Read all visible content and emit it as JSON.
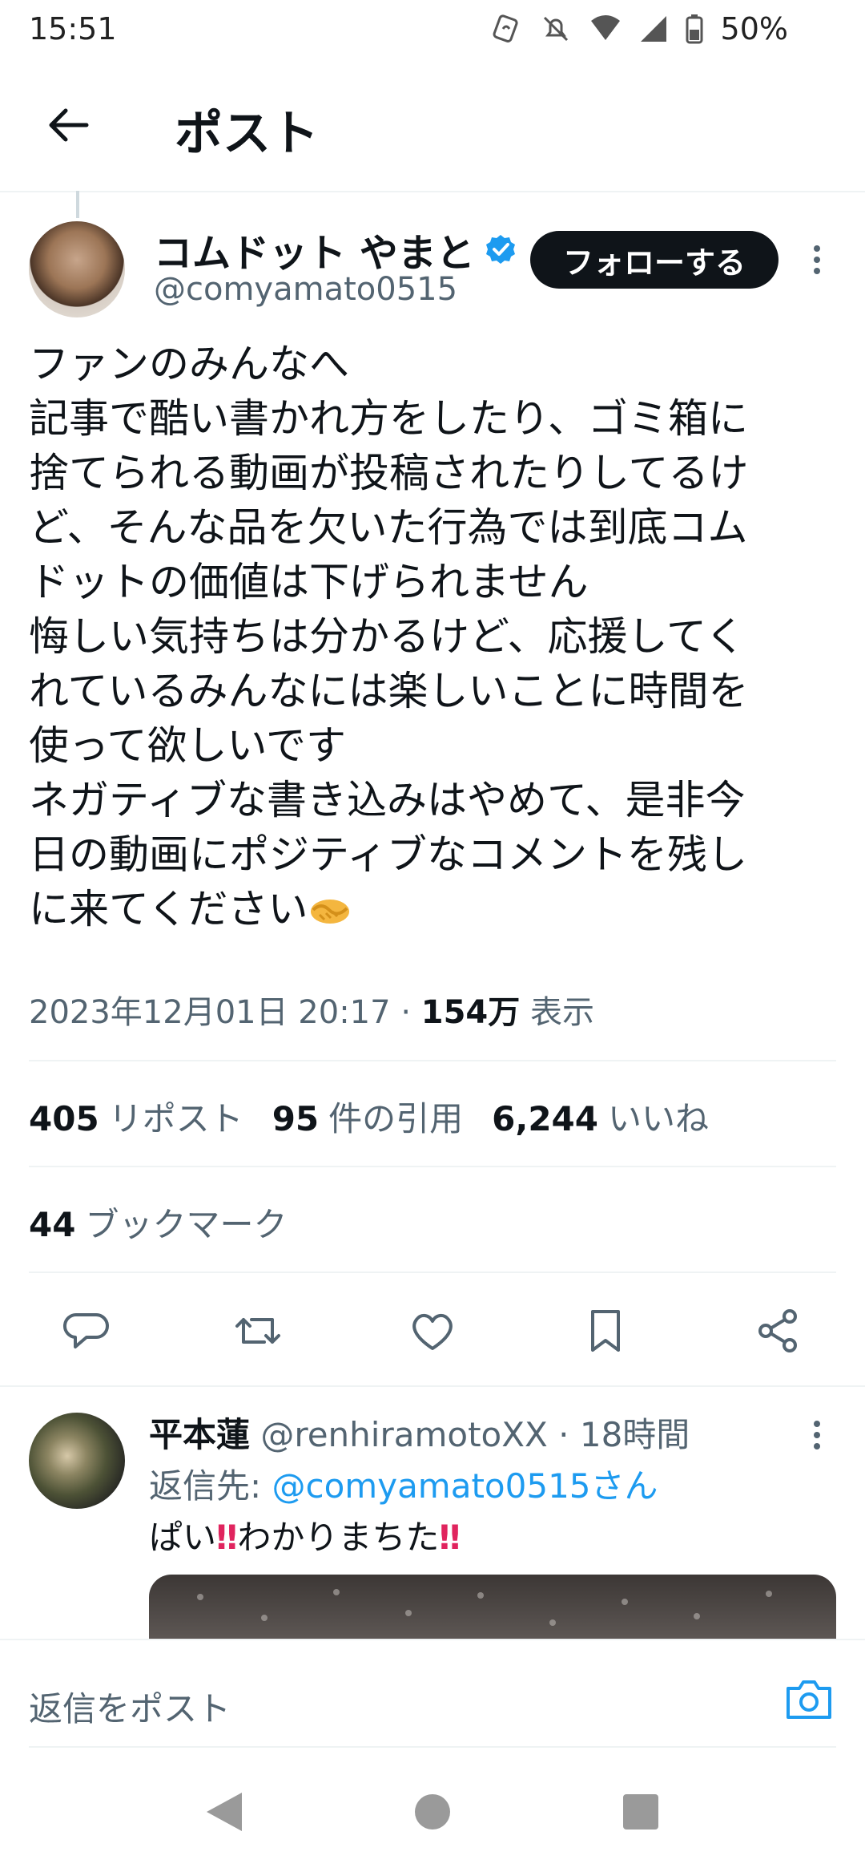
{
  "status_bar": {
    "time": "15:51",
    "battery": "50%"
  },
  "header": {
    "title": "ポスト"
  },
  "post": {
    "display_name": "コムドット やまと",
    "handle": "@comyamato0515",
    "follow_label": "フォローする",
    "lines": [
      "ファンのみんなへ",
      "記事で酷い書かれ方をしたり、ゴミ箱に",
      "捨てられる動画が投稿されたりしてるけ",
      "ど、そんな品を欠いた行為では到底コム",
      "ドットの価値は下げられません",
      "悔しい気持ちは分かるけど、応援してく",
      "れているみんなには楽しいことに時間を",
      "使って欲しいです",
      "ネガティブな書き込みはやめて、是非今",
      "日の動画にポジティブなコメントを残し",
      "に来てください"
    ],
    "timestamp": "2023年12月01日 20:17",
    "separator": "·",
    "views_count": "154万",
    "views_label": "表示",
    "reposts_count": "405",
    "reposts_label": "リポスト",
    "quotes_count": "95",
    "quotes_label": "件の引用",
    "likes_count": "6,244",
    "likes_label": "いいね",
    "bookmarks_count": "44",
    "bookmarks_label": "ブックマーク"
  },
  "actions": [
    "reply-icon",
    "repost-icon",
    "like-icon",
    "bookmark-icon",
    "share-icon"
  ],
  "reply": {
    "display_name": "平本蓮",
    "handle": "@renhiramotoXX",
    "time": "· 18時間",
    "reply_to_label": "返信先:",
    "reply_to_handle": "@comyamato0515さん",
    "text_1": "ぱい",
    "text_2": "わかりまちた",
    "bang": "‼"
  },
  "composer": {
    "placeholder": "返信をポスト"
  },
  "colors": {
    "accent": "#1d9bf0",
    "text": "#0f1419",
    "secondary": "#536471",
    "alert": "#e0245e"
  }
}
